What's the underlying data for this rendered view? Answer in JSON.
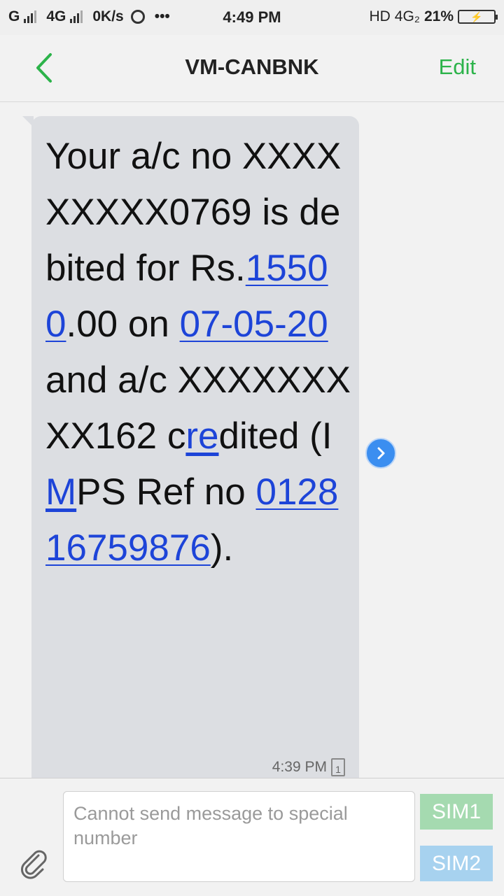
{
  "status_bar": {
    "network1": "G",
    "network2": "4G",
    "speed": "0K/s",
    "more": "•••",
    "time": "4:49 PM",
    "hd": "HD",
    "net_right": "4G₂",
    "battery_percent": "21%"
  },
  "header": {
    "title": "VM-CANBNK",
    "edit_label": "Edit"
  },
  "message": {
    "parts": {
      "p1": "Your a/c no XXXXXXXXX0769 is debited for Rs.",
      "amount": "15500",
      "p2": ".00 on ",
      "date": "07-05-20",
      "p3": " and a/c XXXXXXXXX162 c",
      "re": "re",
      "p4": "dited (I",
      "m": "M",
      "p5": "PS Ref no ",
      "ref": "012816759876",
      "p6": ")."
    },
    "time": "4:39 PM",
    "sim_slot": "1"
  },
  "composer": {
    "placeholder": "Cannot send message to special number",
    "sim1_label": "SIM1",
    "sim2_label": "SIM2"
  },
  "colors": {
    "accent_green": "#2cb34a",
    "link_blue": "#1d44d8",
    "bubble_bg": "#dcdee2"
  }
}
